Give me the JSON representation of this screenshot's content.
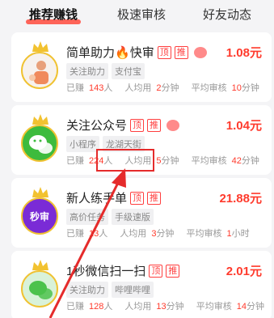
{
  "tabs": [
    {
      "label": "推荐赚钱",
      "active": true
    },
    {
      "label": "极速审核",
      "active": false
    },
    {
      "label": "好友动态",
      "active": false
    }
  ],
  "cards": [
    {
      "title": "简单助力",
      "title_suffix": "快审",
      "fire_glyph": "🔥",
      "badges": [
        "顶",
        "推"
      ],
      "price": "1.08元",
      "tags": [
        "关注助力",
        "支付宝"
      ],
      "earned": "143",
      "avg_time": "2",
      "review_time": "10",
      "earned_prefix": "已赚",
      "earned_suffix": "人",
      "avg_prefix": "人均用",
      "avg_suffix": "分钟",
      "review_prefix": "平均审核",
      "review_suffix": "分钟"
    },
    {
      "title": "关注公众号",
      "badges": [
        "顶",
        "推"
      ],
      "price": "1.04元",
      "tags": [
        "小程序",
        "龙湖天街"
      ],
      "earned": "224",
      "avg_time": "5",
      "review_time": "42",
      "earned_prefix": "已赚",
      "earned_suffix": "人",
      "avg_prefix": "人均用",
      "avg_suffix": "分钟",
      "review_prefix": "平均审核",
      "review_suffix": "分钟"
    },
    {
      "title": "新人练手单",
      "badges": [
        "顶",
        "推"
      ],
      "price": "21.88元",
      "tags": [
        "高价任务",
        "手级速版"
      ],
      "earned": "13",
      "avg_time": "3",
      "review_time": "1",
      "avatar_text": "秒审",
      "earned_prefix": "已赚",
      "earned_suffix": "人",
      "avg_prefix": "人均用",
      "avg_suffix": "分钟",
      "review_prefix": "平均审核",
      "review_suffix": "小时"
    },
    {
      "title": "1秒微信扫一扫",
      "badges": [
        "顶",
        "推"
      ],
      "price": "2.01元",
      "tags": [
        "关注助力",
        "哔哩哔哩"
      ],
      "earned": "128",
      "avg_time": "13",
      "review_time": "14",
      "earned_prefix": "已赚",
      "earned_suffix": "人",
      "avg_prefix": "人均用",
      "avg_suffix": "分钟",
      "review_prefix": "平均审核",
      "review_suffix": "分钟"
    }
  ],
  "colors": {
    "accent": "#ff3a2c",
    "highlight": "#e52b2b"
  }
}
